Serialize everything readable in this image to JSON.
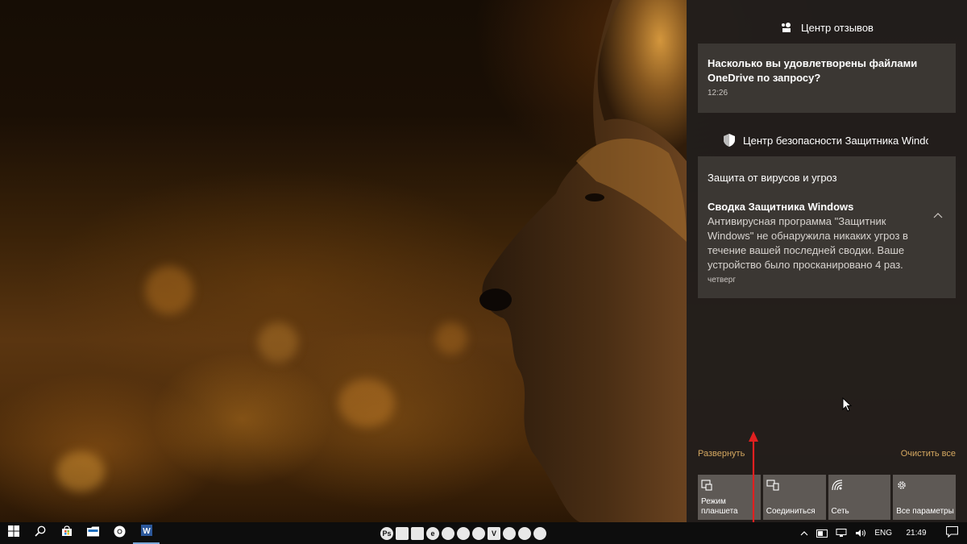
{
  "desktop": {
    "wallpaper": "lion-at-sunset"
  },
  "action_center": {
    "groups": [
      {
        "app": "Центр отзывов",
        "icon": "feedback-hub-icon",
        "notifications": [
          {
            "title": "Насколько вы удовлетворены файлами OneDrive по запросу?",
            "time": "12:26"
          }
        ]
      },
      {
        "app": "Центр безопасности Защитника Windows",
        "icon": "shield-icon",
        "notifications": [
          {
            "heading": "Защита от вирусов и угроз",
            "title": "Сводка Защитника Windows",
            "body": "Антивирусная программа \"Защитник Windows\" не обнаружила никаких угроз в течение вашей последней сводки. Ваше устройство было просканировано 4 раз.",
            "time": "четверг"
          }
        ]
      }
    ],
    "expand_label": "Развернуть",
    "clear_all_label": "Очистить все",
    "quick_actions": [
      {
        "label": "Режим планшета",
        "icon": "tablet-mode-icon"
      },
      {
        "label": "Соединиться",
        "icon": "connect-icon"
      },
      {
        "label": "Сеть",
        "icon": "network-icon"
      },
      {
        "label": "Все параметры",
        "icon": "settings-gear-icon"
      }
    ]
  },
  "taskbar": {
    "left_buttons": [
      "start-icon",
      "search-icon",
      "store-icon",
      "file-explorer-icon",
      "chrome-icon",
      "word-icon"
    ],
    "pinned_center": [
      "Ps",
      "",
      "",
      "e",
      "",
      "",
      "",
      "V",
      "",
      "",
      ""
    ],
    "tray": {
      "language": "ENG",
      "time": "21:49"
    }
  },
  "colors": {
    "panel_bg": "#221e1c",
    "card_bg": "#3b3733",
    "accent_gold": "#d4a860",
    "tile_bg": "#5e5955",
    "annotation_red": "#e02020"
  }
}
